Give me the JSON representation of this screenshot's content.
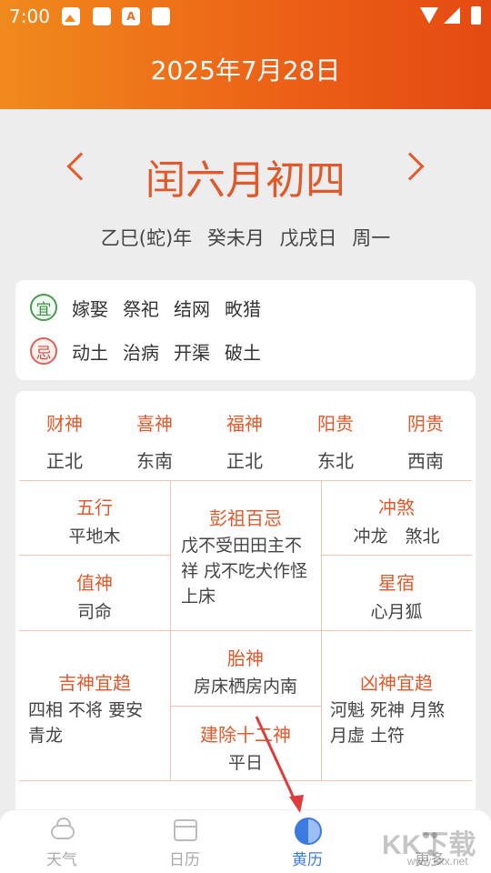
{
  "status_bar": {
    "time": "7:00"
  },
  "header": {
    "title": "2025年7月28日"
  },
  "lunar": {
    "date": "闰六月初四",
    "ganzhi": "乙巳(蛇)年 癸未月 戊戌日 周一"
  },
  "yiji": {
    "yi_label": "宜",
    "yi_items": [
      "嫁娶",
      "祭祀",
      "结网",
      "畋猎"
    ],
    "ji_label": "忌",
    "ji_items": [
      "动土",
      "治病",
      "开渠",
      "破土"
    ]
  },
  "gods": [
    {
      "title": "财神",
      "value": "正北"
    },
    {
      "title": "喜神",
      "value": "东南"
    },
    {
      "title": "福神",
      "value": "正北"
    },
    {
      "title": "阳贵",
      "value": "东北"
    },
    {
      "title": "阴贵",
      "value": "西南"
    }
  ],
  "grid": {
    "wuxing": {
      "title": "五行",
      "value": "平地木"
    },
    "pengzu": {
      "title": "彭祖百忌",
      "value": "戊不受田田主不祥 戌不吃犬作怪上床"
    },
    "chongsha": {
      "title": "冲煞",
      "value": "冲龙　煞北"
    },
    "zhishen": {
      "title": "值神",
      "value": "司命"
    },
    "xingxiu": {
      "title": "星宿",
      "value": "心月狐"
    },
    "jishen": {
      "title": "吉神宜趋",
      "value": "四相 不将 要安 青龙"
    },
    "taishen": {
      "title": "胎神",
      "value": "房床栖房内南"
    },
    "xiongshen": {
      "title": "凶神宜趋",
      "value": "河魁 死神 月煞 月虚 土符"
    },
    "jianchu": {
      "title": "建除十二神",
      "value": "平日"
    }
  },
  "nav": [
    {
      "label": "天气",
      "icon": "weather-icon"
    },
    {
      "label": "日历",
      "icon": "calendar-icon"
    },
    {
      "label": "黄历",
      "icon": "yinyang-icon"
    },
    {
      "label": "更多",
      "icon": "more-icon"
    }
  ],
  "watermark": {
    "text": "KK下载",
    "url": "www.kkx.net"
  },
  "colors": {
    "accent": "#e0592a",
    "header_start": "#f08a1c",
    "header_end": "#e44a12",
    "nav_active": "#3b7be0"
  }
}
